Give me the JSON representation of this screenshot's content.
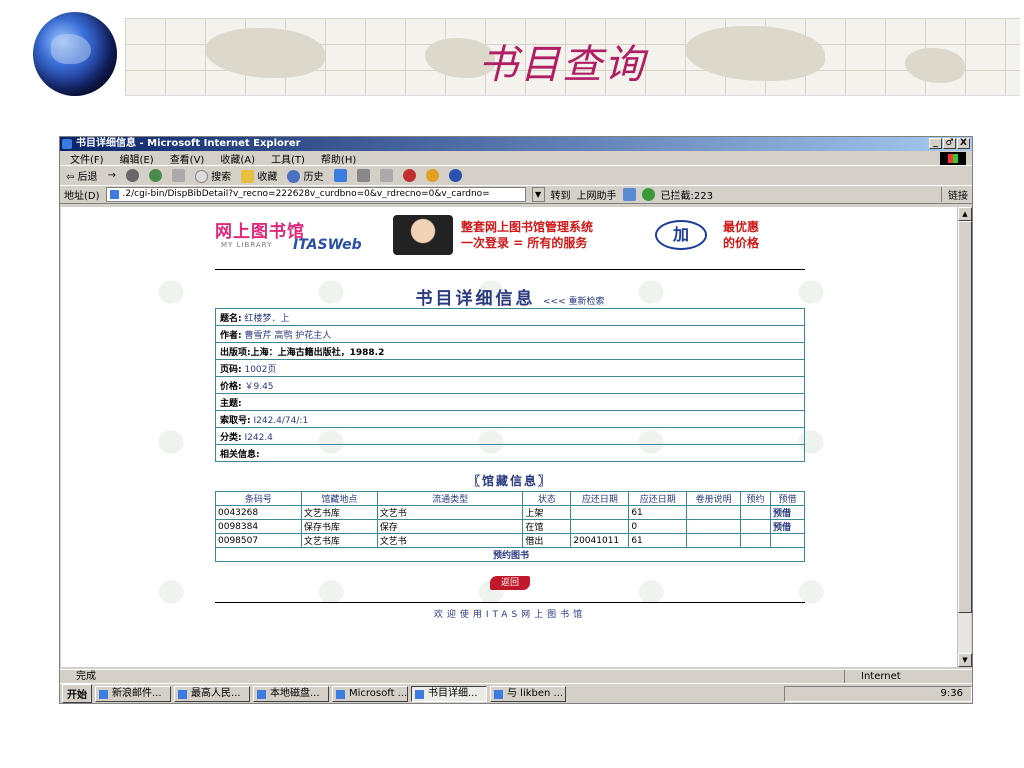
{
  "slide": {
    "title": "书目查询"
  },
  "window": {
    "title": "书目详细信息 - Microsoft Internet Explorer",
    "buttons": [
      "_",
      "♂",
      "X"
    ]
  },
  "menubar": [
    "文件(F)",
    "编辑(E)",
    "查看(V)",
    "收藏(A)",
    "工具(T)",
    "帮助(H)"
  ],
  "toolbar": {
    "back": "⇦ 后退",
    "search": "搜索",
    "favorites": "收藏",
    "history": "历史"
  },
  "addressbar": {
    "label": "地址(D)",
    "url": ".2/cgi-bin/DispBibDetail?v_recno=222628v_curdbno=0&v_rdrecno=0&v_cardno=",
    "go": "转到",
    "assistant": "上网助手",
    "blocked": "已拦截:223",
    "links": "链接"
  },
  "banner": {
    "logo": "网上图书馆",
    "logo_sub": "MY LIBRARY",
    "itas": "ITASWeb",
    "ad_line1": "整套网上图书馆管理系统",
    "ad_line2": "一次登录 = 所有的服务",
    "badge": "加",
    "price_line1": "最优惠",
    "price_line2": "的价格"
  },
  "detail": {
    "title": "书目详细信息",
    "research_link": "<<< 重新检索",
    "fields": [
      {
        "label": "题名:",
        "value": "红楼梦．上"
      },
      {
        "label": "作者:",
        "value": "曹雪芹  高鹗  护花主人"
      },
      {
        "label": "出版项:",
        "value": "上海：上海古籍出版社，1988.2"
      },
      {
        "label": "页码:",
        "value": "1002页"
      },
      {
        "label": "价格:",
        "value": "￥9.45"
      },
      {
        "label": "主题:",
        "value": ""
      },
      {
        "label": "索取号:",
        "value": "I242.4/74/:1"
      },
      {
        "label": "分类:",
        "value": "I242.4"
      },
      {
        "label": "相关信息:",
        "value": ""
      }
    ]
  },
  "holdings": {
    "title": "〖馆藏信息〗",
    "headers": [
      "条码号",
      "馆藏地点",
      "流通类型",
      "状态",
      "应还日期",
      "应还日期",
      "卷册说明",
      "预约",
      "预借"
    ],
    "rows": [
      [
        "0043268",
        "文艺书库",
        "文艺书",
        "上架",
        "",
        "61",
        "",
        "",
        "预借"
      ],
      [
        "0098384",
        "保存书库",
        "保存",
        "在馆",
        "",
        "0",
        "",
        "",
        "预借"
      ],
      [
        "0098507",
        "文艺书库",
        "文艺书",
        "借出",
        "20041011",
        "61",
        "",
        "",
        ""
      ]
    ],
    "reserve": "预约图书"
  },
  "back_button": "返回",
  "footer": "欢迎使用ITAS网上图书馆",
  "status": {
    "text": "完成",
    "zone": "Internet"
  },
  "taskbar": {
    "start": "开始",
    "tasks": [
      "新浪邮件...",
      "最高人民...",
      "本地磁盘...",
      "Microsoft ...",
      "书目详细...",
      "与 likben ..."
    ],
    "clock": "9:36"
  }
}
